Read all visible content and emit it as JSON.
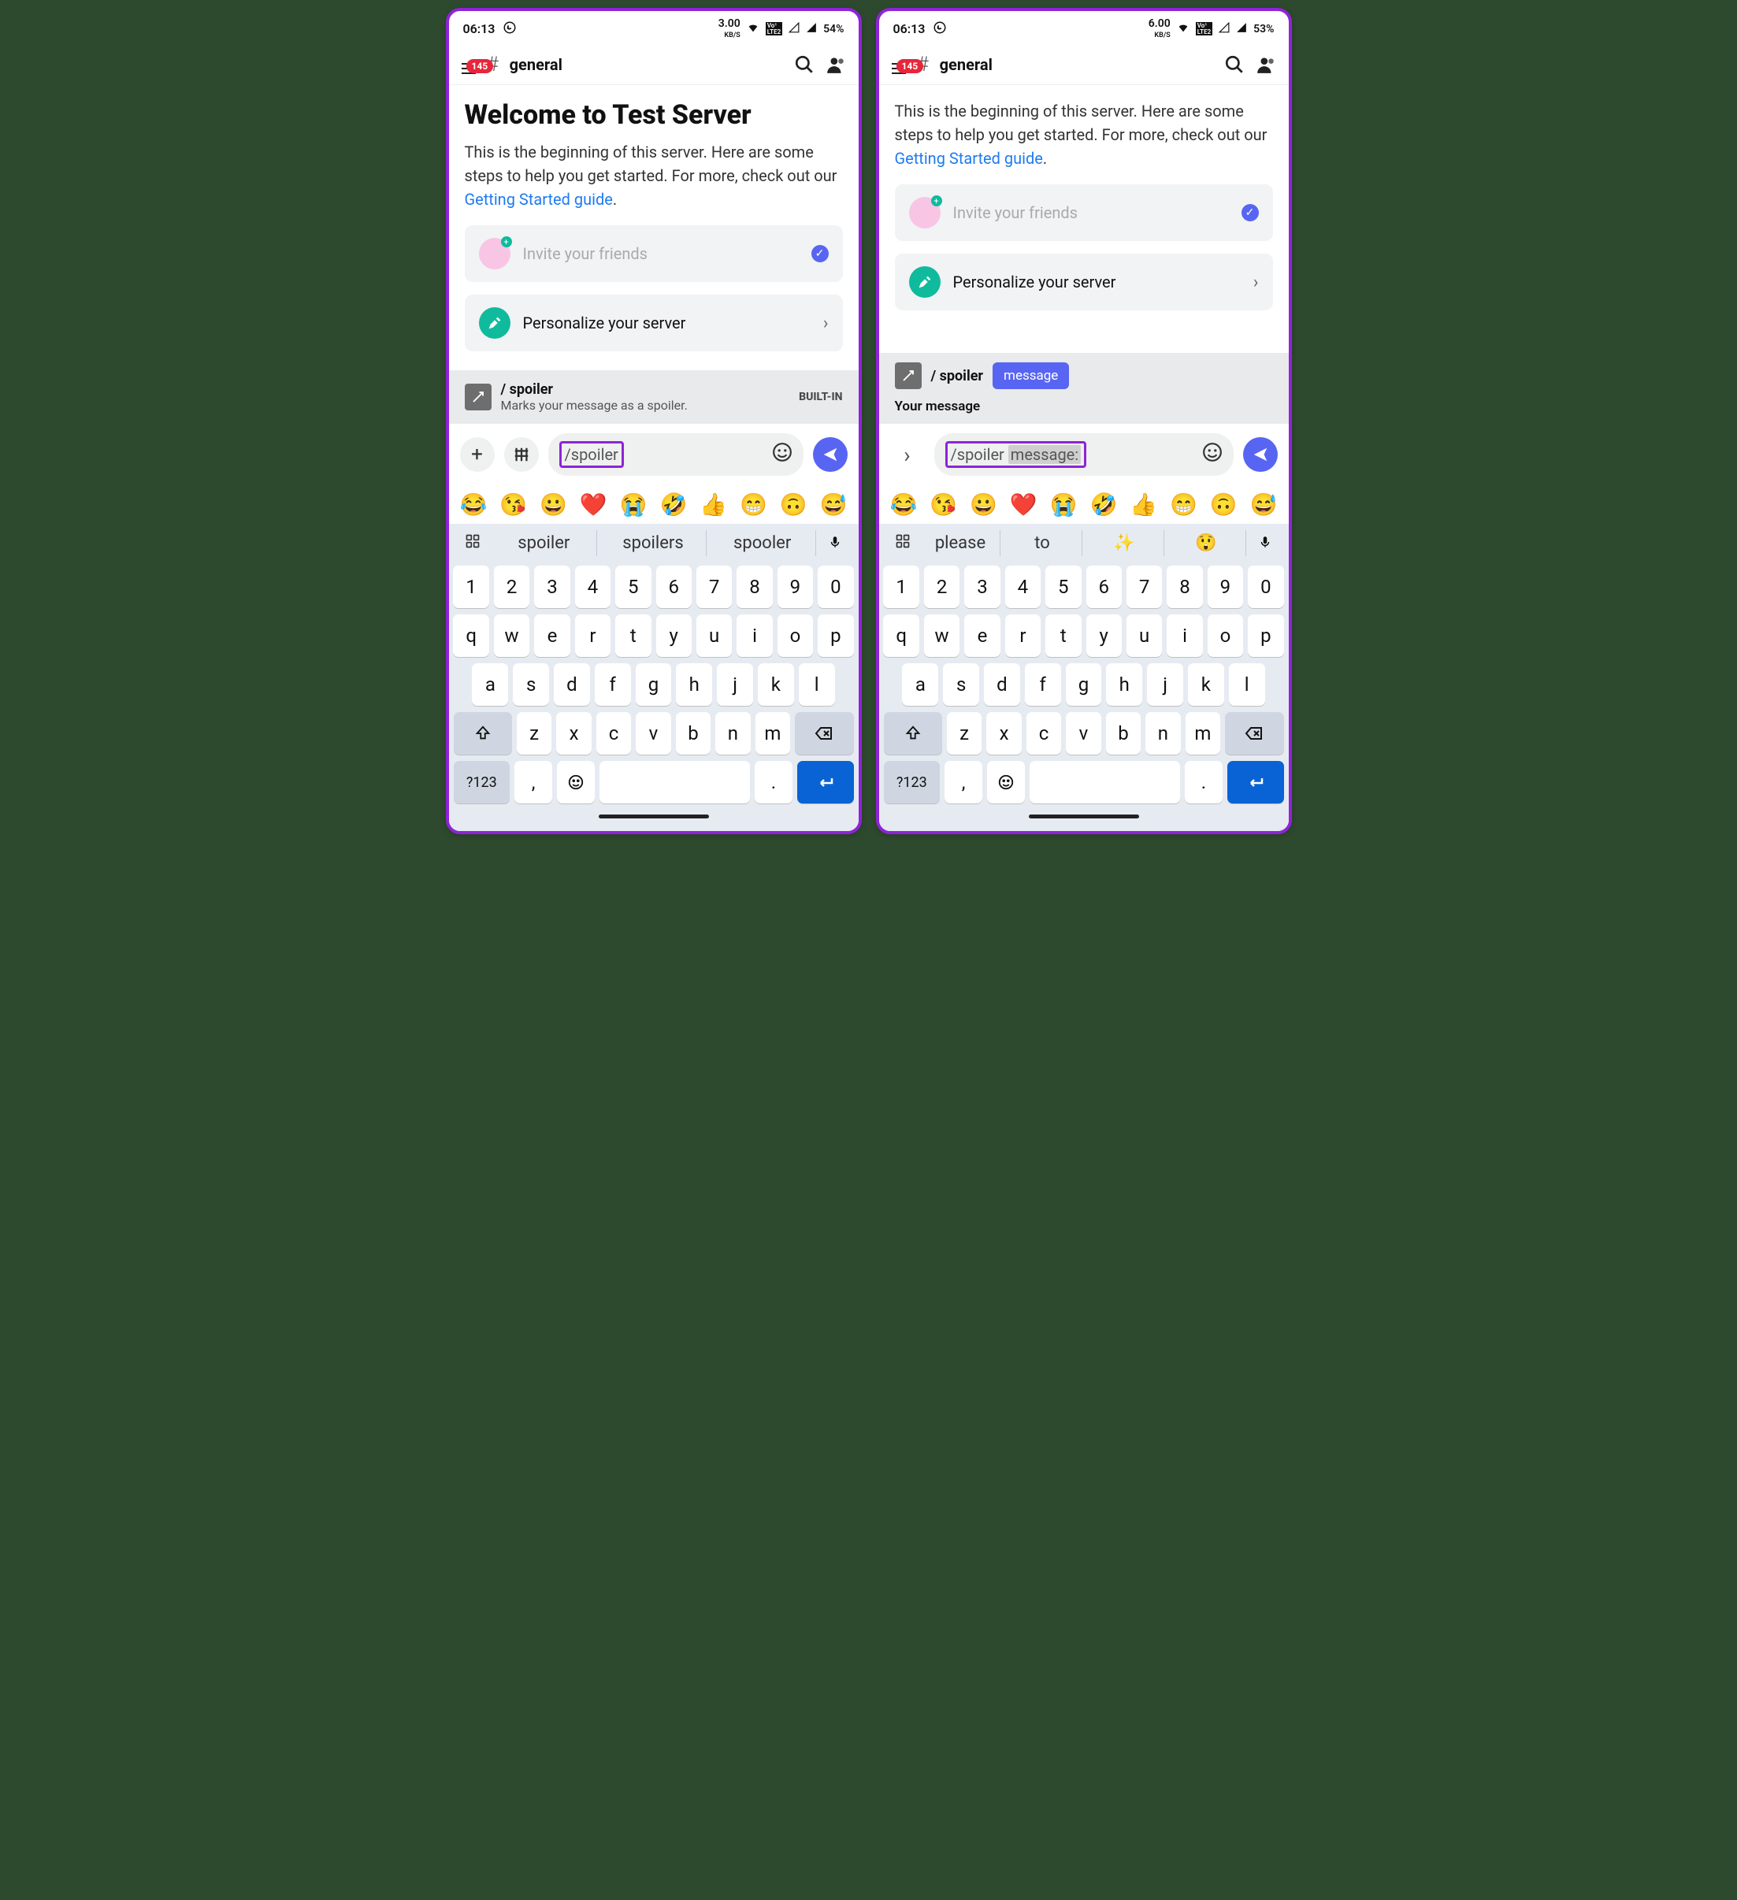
{
  "left": {
    "status": {
      "time": "06:13",
      "kbs": "3.00",
      "kbs_unit": "KB/S",
      "battery": "54%"
    },
    "header": {
      "badge": "145",
      "channel": "general"
    },
    "content": {
      "welcome": "Welcome to Test Server",
      "intro_a": "This is the beginning of this server. Here are some steps to help you get started. For more, check out our ",
      "intro_link": "Getting Started guide",
      "intro_b": ".",
      "step_invite": "Invite your friends",
      "step_personalize": "Personalize your server"
    },
    "cmd": {
      "name": "/ spoiler",
      "desc": "Marks your message as a spoiler.",
      "tag": "BUILT-IN"
    },
    "input": {
      "text": "/spoiler"
    },
    "sugg": [
      "spoiler",
      "spoilers",
      "spooler"
    ]
  },
  "right": {
    "status": {
      "time": "06:13",
      "kbs": "6.00",
      "kbs_unit": "KB/S",
      "battery": "53%"
    },
    "header": {
      "badge": "145",
      "channel": "general"
    },
    "content": {
      "intro_a": "This is the beginning of this server. Here are some steps to help you get started. For more, check out our ",
      "intro_link": "Getting Started guide",
      "intro_b": ".",
      "step_invite": "Invite your friends",
      "step_personalize": "Personalize your server"
    },
    "chip": {
      "cmd": "/ spoiler",
      "param": "message",
      "paramlabel": "Your message"
    },
    "input": {
      "text": "/spoiler ",
      "arg": "message:"
    },
    "sugg": [
      "please",
      "to"
    ]
  },
  "kbd": {
    "row1": [
      "1",
      "2",
      "3",
      "4",
      "5",
      "6",
      "7",
      "8",
      "9",
      "0"
    ],
    "row2": [
      "q",
      "w",
      "e",
      "r",
      "t",
      "y",
      "u",
      "i",
      "o",
      "p"
    ],
    "row3": [
      "a",
      "s",
      "d",
      "f",
      "g",
      "h",
      "j",
      "k",
      "l"
    ],
    "row4": [
      "z",
      "x",
      "c",
      "v",
      "b",
      "n",
      "m"
    ],
    "sym": "?123",
    "comma": ",",
    "dot": "."
  },
  "emoji": [
    "😂",
    "😘",
    "😀",
    "❤️",
    "😭",
    "🤣",
    "👍",
    "😁",
    "🙃",
    "😅"
  ]
}
